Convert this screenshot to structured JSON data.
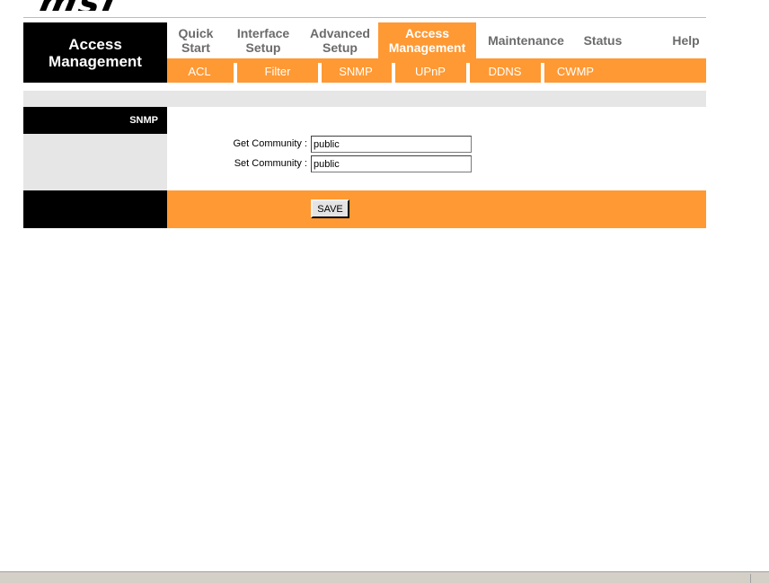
{
  "brand": {
    "logo_text": "msi"
  },
  "section_title": "Access Management",
  "nav": {
    "tabs": [
      {
        "label": "Quick Start",
        "active": false
      },
      {
        "label": "Interface Setup",
        "active": false
      },
      {
        "label": "Advanced Setup",
        "active": false
      },
      {
        "label": "Access Management",
        "active": true
      },
      {
        "label": "Maintenance",
        "active": false
      },
      {
        "label": "Status",
        "active": false
      },
      {
        "label": "Help",
        "active": false
      }
    ]
  },
  "subnav": {
    "items": [
      {
        "label": "ACL"
      },
      {
        "label": "Filter"
      },
      {
        "label": "SNMP"
      },
      {
        "label": "UPnP"
      },
      {
        "label": "DDNS"
      },
      {
        "label": "CWMP"
      }
    ]
  },
  "page": {
    "sidebar_label": "SNMP"
  },
  "form": {
    "get_community_label": "Get Community :",
    "get_community_value": "public",
    "set_community_label": "Set Community :",
    "set_community_value": "public"
  },
  "actions": {
    "save_label": "SAVE"
  },
  "colors": {
    "accent": "#ff9933",
    "dark": "#000000",
    "band": "#e6e6e6",
    "tab_text": "#6b6b6b"
  }
}
